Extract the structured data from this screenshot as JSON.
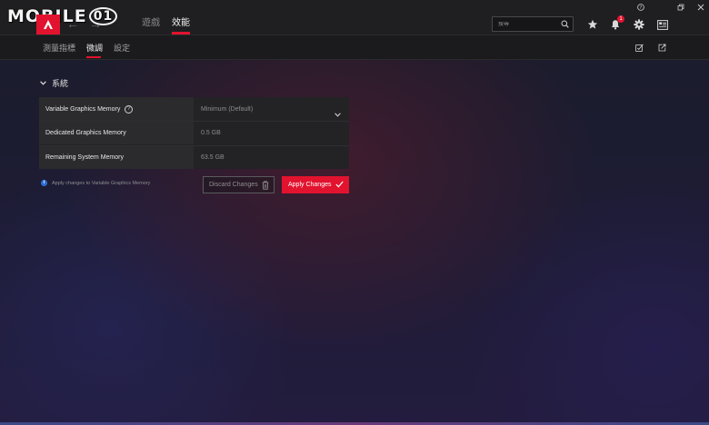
{
  "watermark": {
    "text": "MOBILE",
    "number": "01"
  },
  "window": {
    "help_icon": "question-circle-icon",
    "restore_icon": "restore-icon",
    "close_icon": "close-icon"
  },
  "top_nav": {
    "tabs": [
      {
        "label": "遊戲",
        "active": false
      },
      {
        "label": "效能",
        "active": true
      }
    ],
    "search_placeholder": "搜尋",
    "notification_count": "1"
  },
  "sub_nav": {
    "tabs": [
      {
        "label": "測量指標",
        "active": false
      },
      {
        "label": "微調",
        "active": true
      },
      {
        "label": "設定",
        "active": false
      }
    ]
  },
  "section": {
    "title": "系統",
    "rows": [
      {
        "label": "Variable Graphics Memory",
        "value": "Minimum (Default)",
        "has_help": true,
        "dropdown": true
      },
      {
        "label": "Dedicated Graphics Memory",
        "value": "0.5 GB"
      },
      {
        "label": "Remaining System Memory",
        "value": "63.5 GB"
      }
    ]
  },
  "footer": {
    "info_text": "Apply changes to Variable Graphics Memory",
    "discard_label": "Discard Changes",
    "apply_label": "Apply Changes"
  },
  "colors": {
    "accent": "#e2132e",
    "info": "#2f6fd6"
  }
}
